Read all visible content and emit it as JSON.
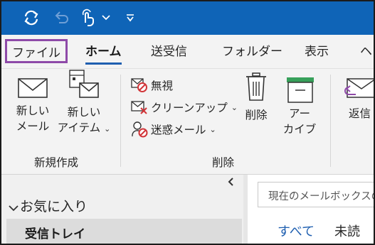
{
  "qat": {
    "sync_icon": "sync-icon",
    "undo_icon": "undo-icon",
    "touch_icon": "touch-mode-icon",
    "customize_icon": "customize-qat-icon"
  },
  "tabs": [
    {
      "label": "ファイル"
    },
    {
      "label": "ホーム"
    },
    {
      "label": "送受信"
    },
    {
      "label": "フォルダー"
    },
    {
      "label": "表示"
    },
    {
      "label": "ヘ"
    }
  ],
  "ribbon": {
    "new_group": {
      "new_mail": {
        "line1": "新しい",
        "line2": "メール"
      },
      "new_item": {
        "line1": "新しい",
        "line2": "アイテム"
      },
      "label": "新規作成"
    },
    "delete_group": {
      "ignore": "無視",
      "cleanup": "クリーンアップ",
      "junk": "迷惑メール",
      "delete": "削除",
      "archive": {
        "line1": "アー",
        "line2": "カイブ"
      },
      "label": "削除"
    },
    "reply": {
      "label": "返信"
    }
  },
  "nav": {
    "favorites": "お気に入り",
    "inbox": "受信トレイ"
  },
  "mail": {
    "search_placeholder": "現在のメールボックスの",
    "filter_all": "すべて",
    "filter_unread": "未読"
  },
  "colors": {
    "titlebar": "#0f64b7",
    "file_highlight": "#8e4aa8",
    "accent": "#1f5fb0",
    "delete_red": "#d13438"
  }
}
